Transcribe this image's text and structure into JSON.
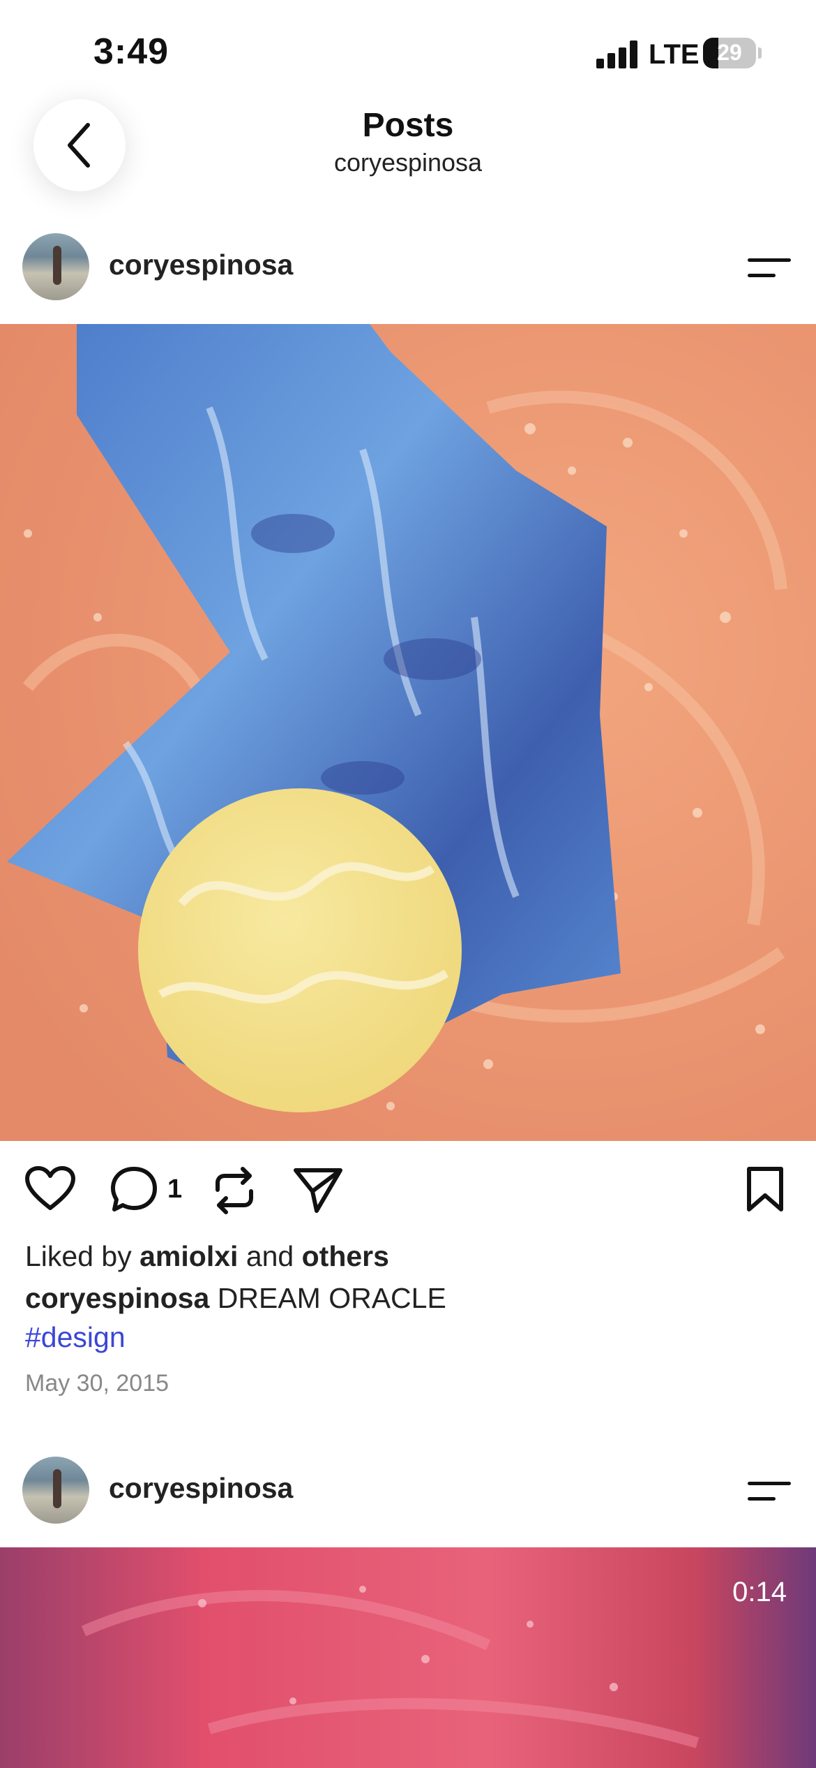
{
  "status_bar": {
    "time": "3:49",
    "network": "LTE",
    "battery_level": "29",
    "battery_percent": 29
  },
  "header": {
    "title": "Posts",
    "subtitle": "coryespinosa",
    "back_icon": "chevron-left-icon"
  },
  "posts": [
    {
      "username": "coryespinosa",
      "liked_by_prefix": "Liked by",
      "liked_by_user": "amiolxi",
      "liked_by_and": "and",
      "liked_by_others": "others",
      "comment_count": "1",
      "caption_user": "coryespinosa",
      "caption_text": "DREAM ORACLE",
      "hashtag": "#design",
      "date": "May 30, 2015"
    },
    {
      "username": "coryespinosa",
      "video_duration": "0:14"
    }
  ],
  "colors": {
    "hashtag": "#3b46d6",
    "date": "#888888",
    "orange_bg": "#ec9a73",
    "blue_shape": "#5a8ed6",
    "yellow_circle": "#f2e08a",
    "pink_bg": "#e25a74"
  },
  "icons": [
    "heart-icon",
    "comment-icon",
    "repost-icon",
    "share-icon",
    "bookmark-icon",
    "menu-icon"
  ]
}
